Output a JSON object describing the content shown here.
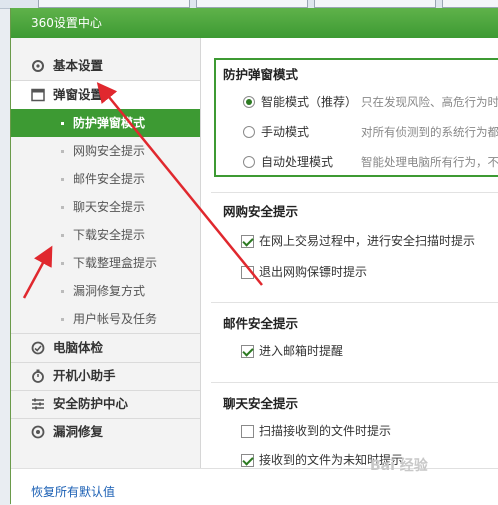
{
  "window": {
    "title": "360设置中心"
  },
  "sidebar": {
    "categories": [
      {
        "label": "基本设置"
      },
      {
        "label": "弹窗设置"
      },
      {
        "label": "电脑体检"
      },
      {
        "label": "开机小助手"
      },
      {
        "label": "安全防护中心"
      },
      {
        "label": "漏洞修复"
      }
    ],
    "subitems": [
      {
        "label": "防护弹窗模式",
        "active": true
      },
      {
        "label": "网购安全提示"
      },
      {
        "label": "邮件安全提示"
      },
      {
        "label": "聊天安全提示"
      },
      {
        "label": "下载安全提示"
      },
      {
        "label": "下载整理盒提示"
      },
      {
        "label": "漏洞修复方式"
      },
      {
        "label": "用户帐号及任务"
      }
    ]
  },
  "content": {
    "mode": {
      "title": "防护弹窗模式",
      "options": [
        {
          "label": "智能模式（推荐）",
          "desc": "只在发现风险、高危行为时于",
          "selected": true
        },
        {
          "label": "手动模式",
          "desc": "对所有侦测到的系统行为都弹",
          "selected": false
        },
        {
          "label": "自动处理模式",
          "desc": "智能处理电脑所有行为，不弹",
          "selected": false
        }
      ]
    },
    "shopping": {
      "title": "网购安全提示",
      "items": [
        {
          "label": "在网上交易过程中，进行安全扫描时提示",
          "checked": true
        },
        {
          "label": "退出网购保镖时提示",
          "checked": false
        }
      ]
    },
    "mail": {
      "title": "邮件安全提示",
      "items": [
        {
          "label": "进入邮箱时提醒",
          "checked": true
        }
      ]
    },
    "chat": {
      "title": "聊天安全提示",
      "items": [
        {
          "label": "扫描接收到的文件时提示",
          "checked": false
        },
        {
          "label": "接收到的文件为未知时提示",
          "checked": true
        }
      ]
    }
  },
  "footer": {
    "restore_label": "恢复所有默认值"
  },
  "watermark": {
    "text": "Bai 经验"
  },
  "colors": {
    "accent": "#3d9a33",
    "annotation": "#e0282e",
    "link": "#1a5fb4"
  }
}
